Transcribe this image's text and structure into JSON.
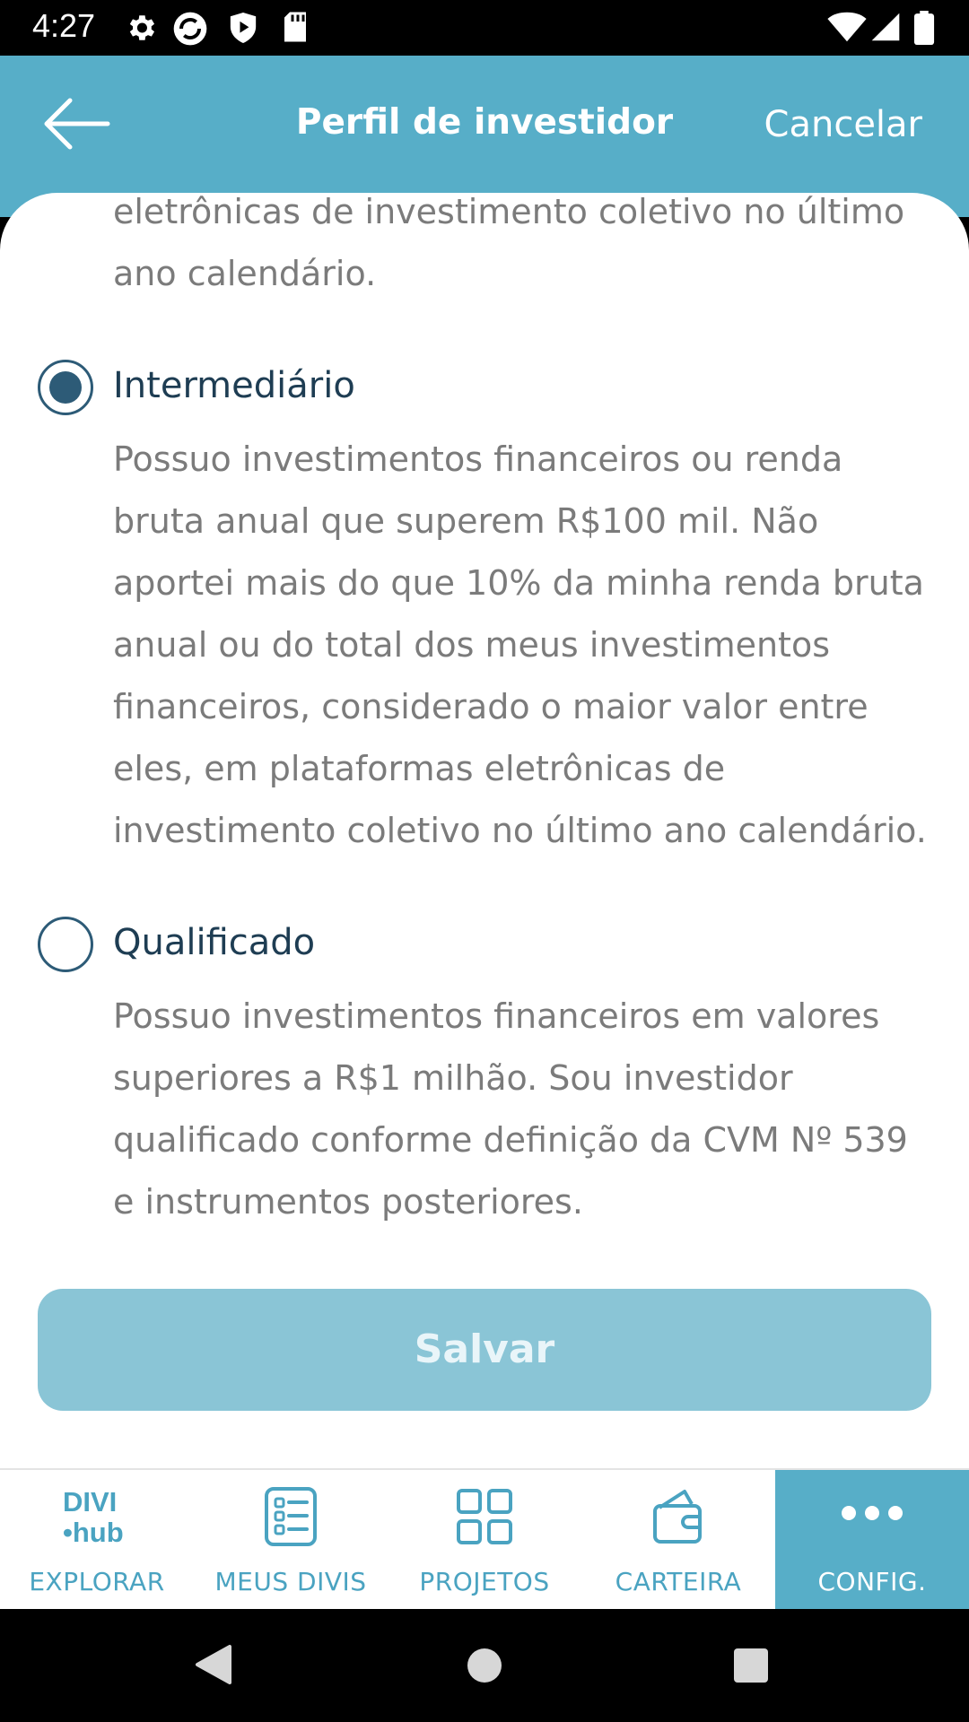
{
  "status_bar": {
    "time": "4:27"
  },
  "header": {
    "title": "Perfil de investidor",
    "cancel_label": "Cancelar"
  },
  "content": {
    "partial_text": "eletrônicas de investimento coletivo no último ano calendário.",
    "options": [
      {
        "label": "Intermediário",
        "selected": true,
        "description": "Possuo investimentos financeiros ou renda bruta anual que superem R$100 mil. Não aportei mais do que 10% da minha renda bruta anual ou do total dos meus investimentos financeiros, considerado o maior valor entre eles, em plataformas eletrônicas de investimento coletivo no último ano calendário."
      },
      {
        "label": "Qualificado",
        "selected": false,
        "description": "Possuo investimentos financeiros em valores superiores a R$1 milhão. Sou investidor qualificado conforme definição da CVM Nº 539 e instrumentos posteriores."
      }
    ],
    "save_label": "Salvar"
  },
  "bottom_nav": {
    "items": [
      {
        "label": "EXPLORAR",
        "icon": "divihub-logo-icon",
        "logo_top": "DIVI",
        "logo_bottom": "•hub"
      },
      {
        "label": "MEUS DIVIS",
        "icon": "list-icon"
      },
      {
        "label": "PROJETOS",
        "icon": "grid-icon"
      },
      {
        "label": "CARTEIRA",
        "icon": "wallet-icon"
      },
      {
        "label": "CONFIG.",
        "icon": "more-dots-icon",
        "active": true
      }
    ]
  },
  "colors": {
    "primary": "#57aec8",
    "dark_text": "#1e3d53",
    "radio": "#2d5b77",
    "button_disabled": "#8ac5d6"
  }
}
